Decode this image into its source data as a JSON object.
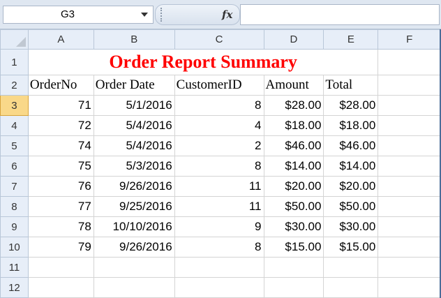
{
  "formula_bar": {
    "name_box": "G3",
    "fx_label": "fx",
    "formula": ""
  },
  "columns": [
    "A",
    "B",
    "C",
    "D",
    "E",
    "F"
  ],
  "rows": [
    "1",
    "2",
    "3",
    "4",
    "5",
    "6",
    "7",
    "8",
    "9",
    "10",
    "11",
    "12"
  ],
  "selected_row": "3",
  "sheet": {
    "title": "Order Report Summary",
    "headers": [
      "OrderNo",
      "Order Date",
      "CustomerID",
      "Amount",
      "Total"
    ],
    "records": [
      [
        "71",
        "5/1/2016",
        "8",
        "$28.00",
        "$28.00"
      ],
      [
        "72",
        "5/4/2016",
        "4",
        "$18.00",
        "$18.00"
      ],
      [
        "74",
        "5/4/2016",
        "2",
        "$46.00",
        "$46.00"
      ],
      [
        "75",
        "5/3/2016",
        "8",
        "$14.00",
        "$14.00"
      ],
      [
        "76",
        "9/26/2016",
        "11",
        "$20.00",
        "$20.00"
      ],
      [
        "77",
        "9/25/2016",
        "11",
        "$50.00",
        "$50.00"
      ],
      [
        "78",
        "10/10/2016",
        "9",
        "$30.00",
        "$30.00"
      ],
      [
        "79",
        "9/26/2016",
        "8",
        "$15.00",
        "$15.00"
      ]
    ]
  },
  "colors": {
    "title": "#ff0000",
    "selected_row_header": "#f9d889",
    "header_background": "#e7eef8"
  }
}
